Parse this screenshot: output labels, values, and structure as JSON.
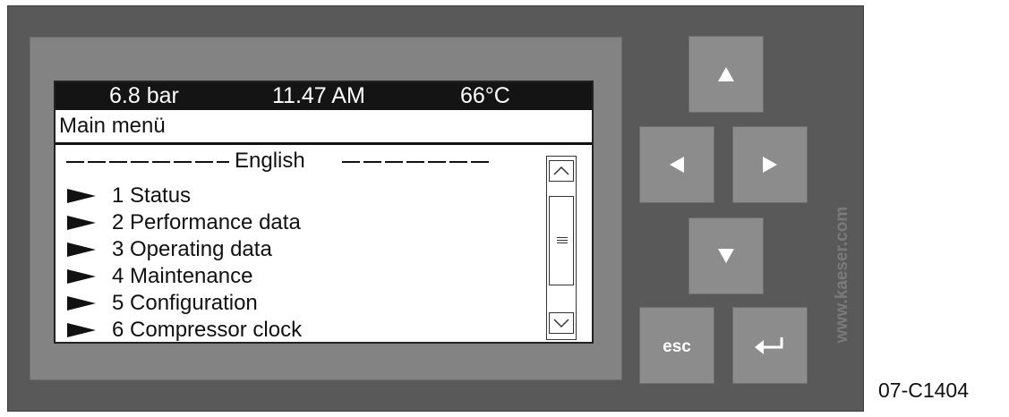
{
  "status_bar": {
    "pressure": "6.8 bar",
    "time": "11.47 AM",
    "temperature": "66°C"
  },
  "screen": {
    "title": "Main menü",
    "language": "English",
    "menu_items": [
      {
        "label": "1 Status"
      },
      {
        "label": "2 Performance data"
      },
      {
        "label": "3 Operating data"
      },
      {
        "label": "4 Maintenance"
      },
      {
        "label": "5 Configuration"
      },
      {
        "label": "6 Compressor clock"
      }
    ]
  },
  "keypad": {
    "up_icon": "arrow-up-icon",
    "left_icon": "arrow-left-icon",
    "right_icon": "arrow-right-icon",
    "down_icon": "arrow-down-icon",
    "esc_label": "esc",
    "enter_icon": "enter-return-icon"
  },
  "watermark": "www.kaeser.com",
  "figure_id": "07-C1404",
  "colors": {
    "panel": "#595959",
    "bezel": "#838383",
    "key": "#8c8c8c",
    "lcd_bar": "#141414",
    "lcd_bg": "#ffffff"
  }
}
